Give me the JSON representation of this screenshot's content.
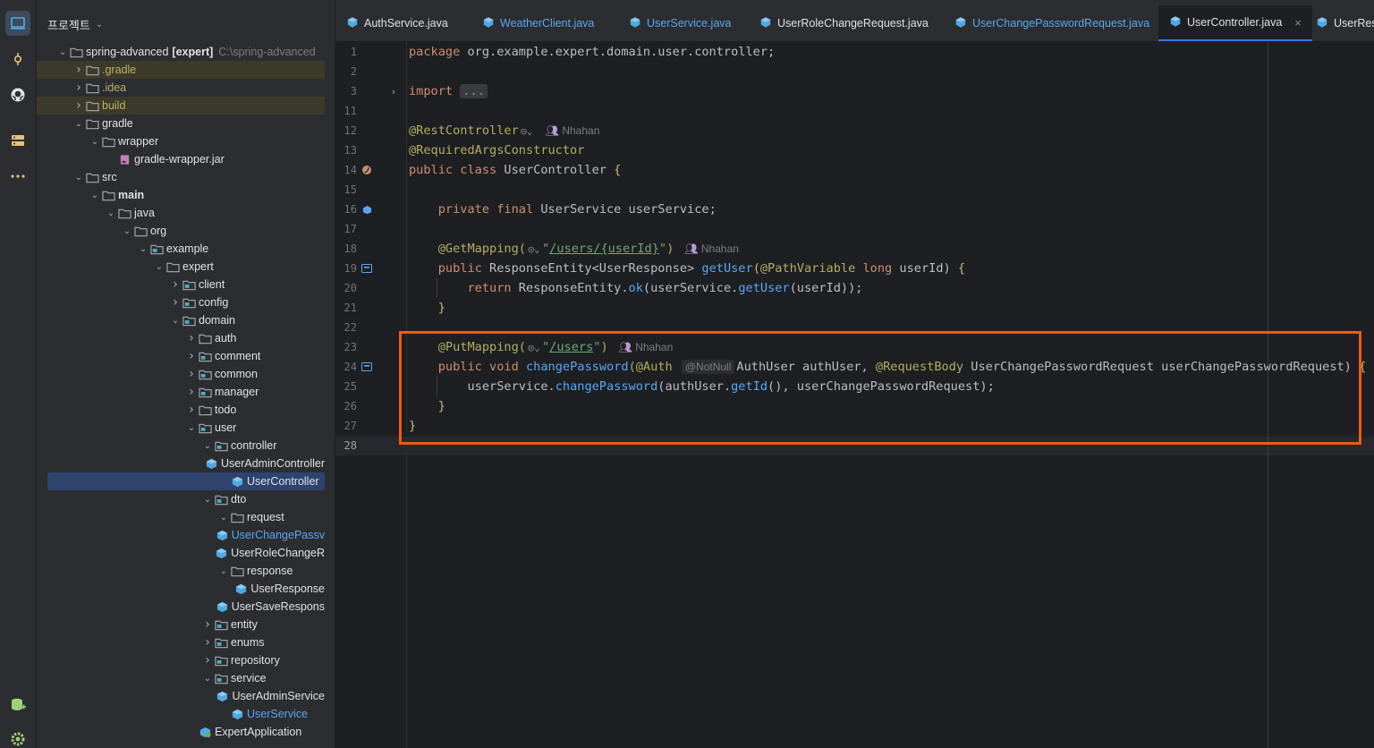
{
  "project_panel": {
    "title": "프로젝트",
    "tree": [
      {
        "depth": 0,
        "arrow": "down",
        "icon": "folder-icon",
        "label": "spring-advanced",
        "bold_suffix": "[expert]",
        "path": "C:\\spring-advanced"
      },
      {
        "depth": 1,
        "arrow": "right",
        "icon": "folder-icon",
        "label": ".gradle",
        "style": "olive",
        "dim": true
      },
      {
        "depth": 1,
        "arrow": "right",
        "icon": "folder-icon",
        "label": ".idea",
        "style": "olive"
      },
      {
        "depth": 1,
        "arrow": "right",
        "icon": "folder-icon",
        "label": "build",
        "style": "olive",
        "dim": true
      },
      {
        "depth": 1,
        "arrow": "down",
        "icon": "folder-icon",
        "label": "gradle"
      },
      {
        "depth": 2,
        "arrow": "down",
        "icon": "folder-icon",
        "label": "wrapper"
      },
      {
        "depth": 3,
        "arrow": "",
        "icon": "jar-icon",
        "label": "gradle-wrapper.jar"
      },
      {
        "depth": 1,
        "arrow": "down",
        "icon": "folder-icon",
        "label": "src"
      },
      {
        "depth": 2,
        "arrow": "down",
        "icon": "folder-icon",
        "label": "main",
        "bold": true
      },
      {
        "depth": 3,
        "arrow": "down",
        "icon": "folder-icon",
        "label": "java"
      },
      {
        "depth": 4,
        "arrow": "down",
        "icon": "folder-icon",
        "label": "org"
      },
      {
        "depth": 5,
        "arrow": "down",
        "icon": "package-icon",
        "label": "example"
      },
      {
        "depth": 6,
        "arrow": "down",
        "icon": "folder-icon",
        "label": "expert"
      },
      {
        "depth": 7,
        "arrow": "right",
        "icon": "package-icon",
        "label": "client"
      },
      {
        "depth": 7,
        "arrow": "right",
        "icon": "package-icon",
        "label": "config"
      },
      {
        "depth": 7,
        "arrow": "down",
        "icon": "package-icon",
        "label": "domain"
      },
      {
        "depth": 8,
        "arrow": "right",
        "icon": "folder-icon",
        "label": "auth"
      },
      {
        "depth": 8,
        "arrow": "right",
        "icon": "package-icon",
        "label": "comment"
      },
      {
        "depth": 8,
        "arrow": "right",
        "icon": "package-icon",
        "label": "common"
      },
      {
        "depth": 8,
        "arrow": "right",
        "icon": "package-icon",
        "label": "manager"
      },
      {
        "depth": 8,
        "arrow": "right",
        "icon": "folder-icon",
        "label": "todo"
      },
      {
        "depth": 8,
        "arrow": "down",
        "icon": "package-icon",
        "label": "user"
      },
      {
        "depth": 9,
        "arrow": "down",
        "icon": "package-icon",
        "label": "controller"
      },
      {
        "depth": 10,
        "arrow": "",
        "icon": "java-class-icon",
        "label": "UserAdminController"
      },
      {
        "depth": 10,
        "arrow": "",
        "icon": "java-class-icon",
        "label": "UserController",
        "selected": true
      },
      {
        "depth": 9,
        "arrow": "down",
        "icon": "package-icon",
        "label": "dto"
      },
      {
        "depth": 10,
        "arrow": "down",
        "icon": "folder-icon",
        "label": "request"
      },
      {
        "depth": 11,
        "arrow": "",
        "icon": "java-class-icon",
        "label": "UserChangePassv",
        "style": "blue"
      },
      {
        "depth": 11,
        "arrow": "",
        "icon": "java-class-icon",
        "label": "UserRoleChangeR"
      },
      {
        "depth": 10,
        "arrow": "down",
        "icon": "folder-icon",
        "label": "response"
      },
      {
        "depth": 11,
        "arrow": "",
        "icon": "java-class-icon",
        "label": "UserResponse"
      },
      {
        "depth": 11,
        "arrow": "",
        "icon": "java-class-icon",
        "label": "UserSaveRespons"
      },
      {
        "depth": 9,
        "arrow": "right",
        "icon": "package-icon",
        "label": "entity"
      },
      {
        "depth": 9,
        "arrow": "right",
        "icon": "package-icon",
        "label": "enums"
      },
      {
        "depth": 9,
        "arrow": "right",
        "icon": "package-icon",
        "label": "repository"
      },
      {
        "depth": 9,
        "arrow": "down",
        "icon": "package-icon",
        "label": "service"
      },
      {
        "depth": 10,
        "arrow": "",
        "icon": "java-class-icon",
        "label": "UserAdminService"
      },
      {
        "depth": 10,
        "arrow": "",
        "icon": "java-class-icon",
        "label": "UserService",
        "style": "blue"
      },
      {
        "depth": 8,
        "arrow": "",
        "icon": "spring-app-icon",
        "label": "ExpertApplication"
      }
    ]
  },
  "tabs": [
    {
      "label": "AuthService.java",
      "style": "normal"
    },
    {
      "label": "WeatherClient.java",
      "style": "blue"
    },
    {
      "label": "UserService.java",
      "style": "blue"
    },
    {
      "label": "UserRoleChangeRequest.java",
      "style": "normal"
    },
    {
      "label": "UserChangePasswordRequest.java",
      "style": "blue"
    },
    {
      "label": "UserController.java",
      "style": "active",
      "close": "×"
    },
    {
      "label": "UserResp",
      "style": "normal"
    }
  ],
  "editor": {
    "line_numbers": [
      "1",
      "2",
      "3",
      "11",
      "12",
      "13",
      "14",
      "15",
      "16",
      "17",
      "18",
      "19",
      "20",
      "21",
      "22",
      "23",
      "24",
      "25",
      "26",
      "27",
      "28"
    ],
    "author": "Nhahan",
    "fold_placeholder": "...",
    "inlay_notnull": "@NotNull",
    "text": {
      "package_kw": "package",
      "package_name": " org.example.expert.domain.user.controller;",
      "import_kw": "import",
      "rest_controller": "@RestController",
      "required_args": "@RequiredArgsConstructor",
      "public_kw": "public",
      "class_kw": "class",
      "class_name": " UserController ",
      "open_brace": "{",
      "private_kw": "private",
      "final_kw": "final",
      "field_decl": " UserService userService;",
      "get_mapping": "@GetMapping(",
      "get_path": "/users/{userId}",
      "close_paren": ")",
      "quote": "\"",
      "get_sig_type": " ResponseEntity<UserResponse> ",
      "get_fn": "getUser",
      "get_sig_open": "(",
      "path_variable": "@PathVariable",
      "long_kw": "long",
      "get_sig_rest": " userId) ",
      "return_kw": "return",
      "return_a": " ResponseEntity.",
      "return_ok": "ok",
      "return_b": "(userService.",
      "return_get": "getUser",
      "return_c": "(userId));",
      "close_brace": "}",
      "put_mapping": "@PutMapping(",
      "put_path": "/users",
      "void_kw": "void",
      "change_fn": "changePassword",
      "auth_ann": "(@Auth",
      "auth_rest": "AuthUser authUser, ",
      "request_body": "@RequestBody",
      "put_sig_rest": " UserChangePasswordRequest userChangePasswordRequest) ",
      "call_a": "userService.",
      "call_fn": "changePassword",
      "call_b": "(authUser.",
      "call_getid": "getId",
      "call_c": "(), userChangePasswordRequest);"
    }
  },
  "colors": {
    "highlight_box": "#f05a12",
    "accent": "#3574f0"
  }
}
